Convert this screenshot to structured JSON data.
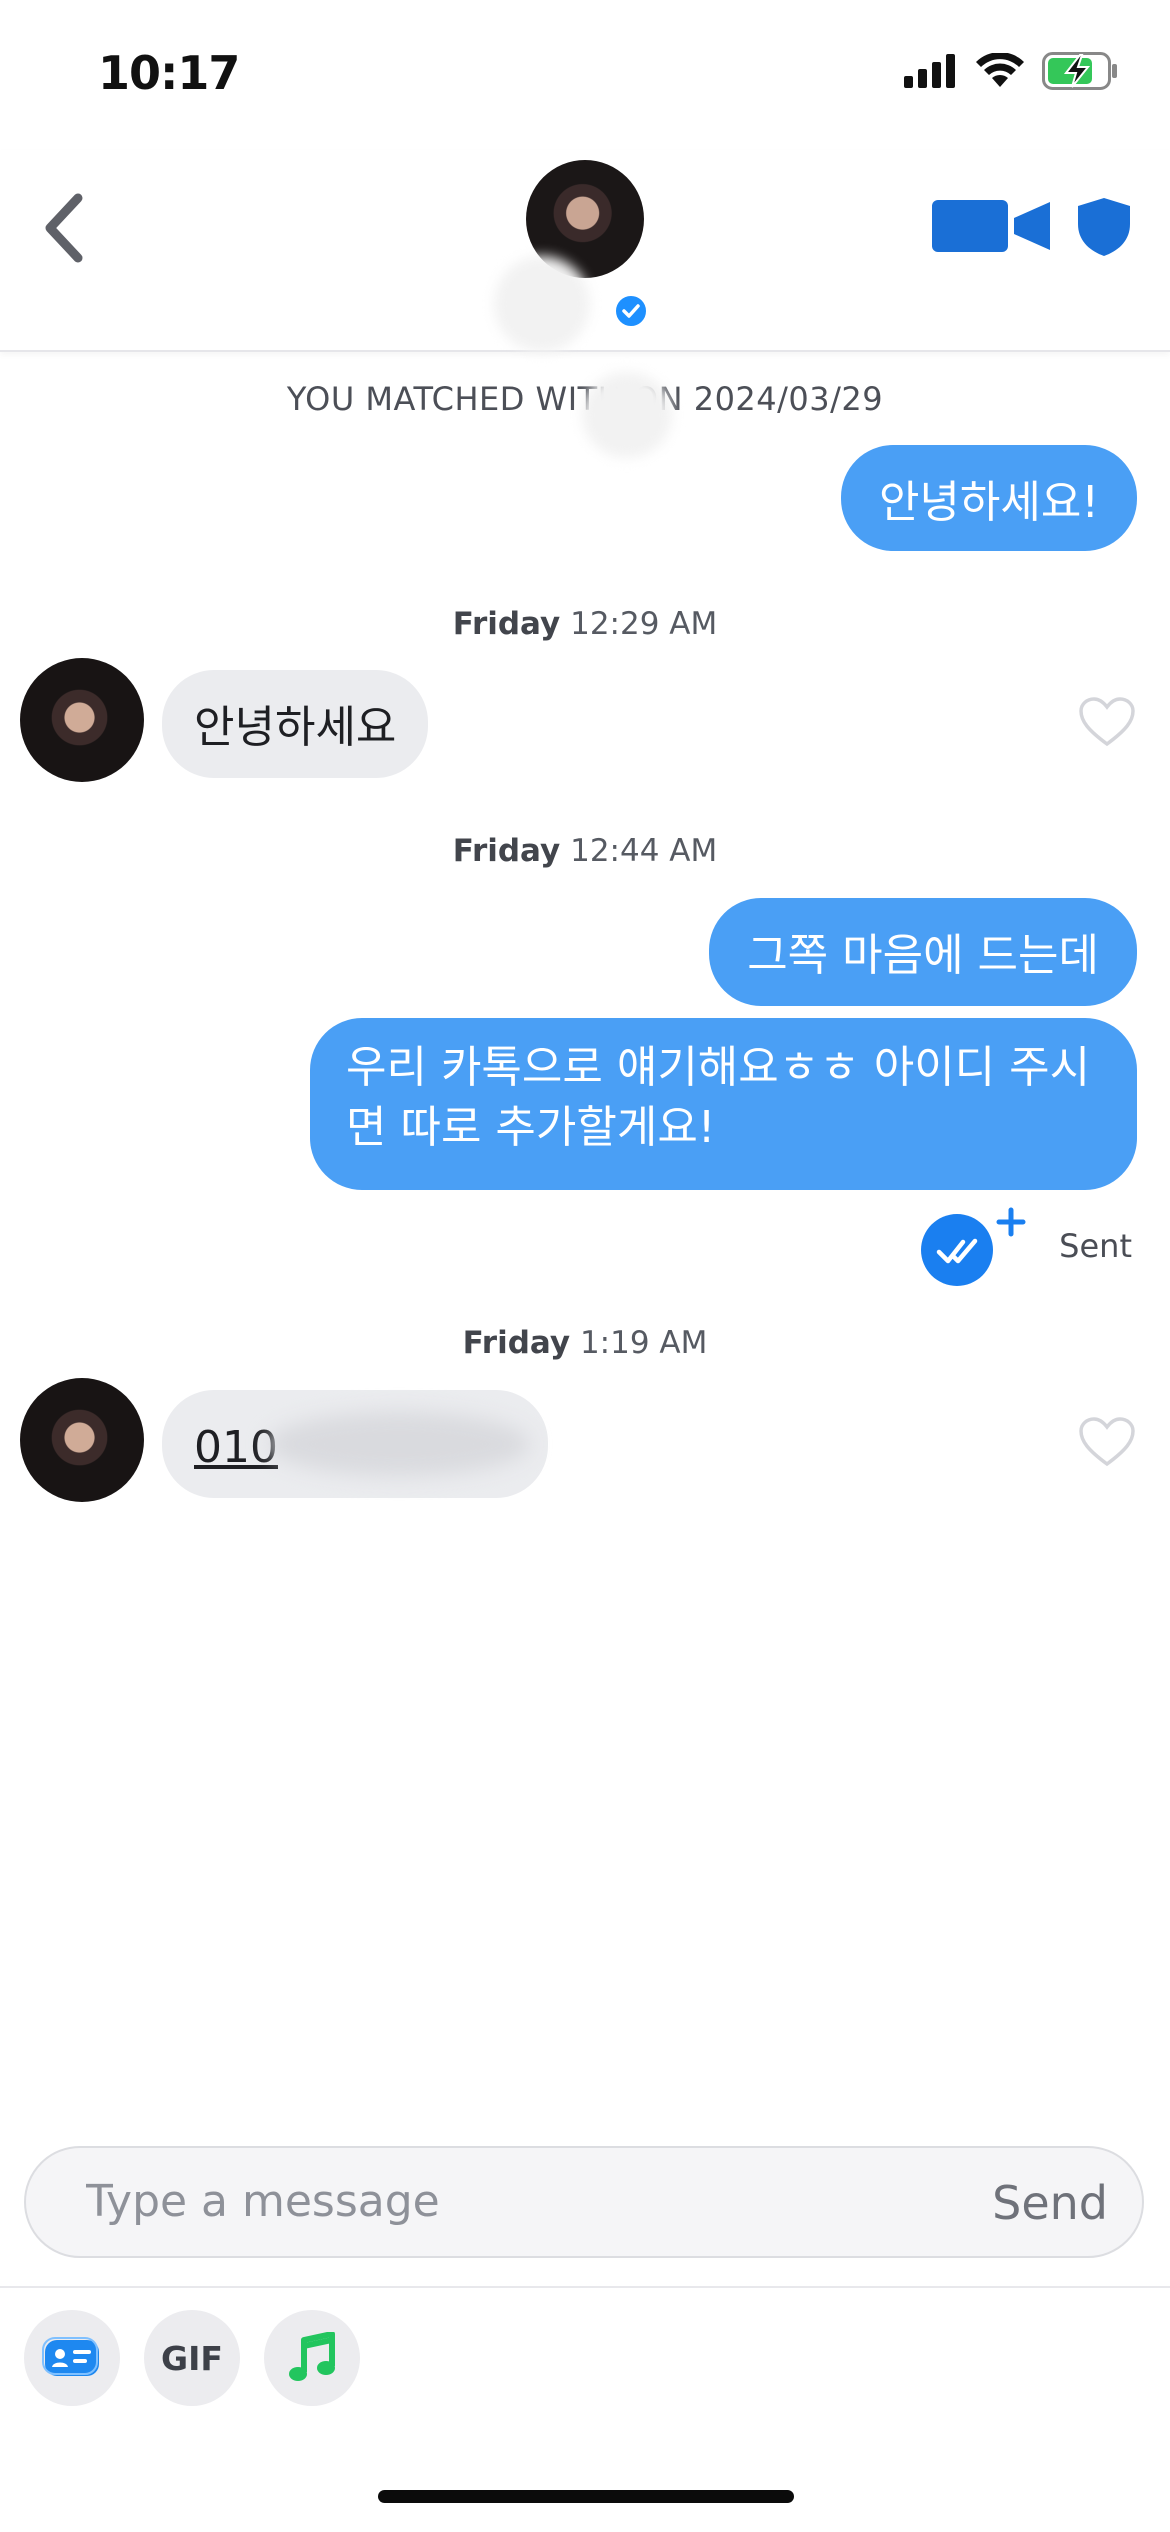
{
  "status_bar": {
    "time": "10:17"
  },
  "header": {
    "back_icon": "chevron-left-icon",
    "verified_icon": "verified-badge-icon",
    "video_icon": "video-camera-icon",
    "shield_icon": "shield-icon"
  },
  "chat": {
    "matched_banner": "YOU MATCHED WITH  ON 2024/03/29",
    "messages": [
      {
        "direction": "out",
        "text": "안녕하세요!"
      },
      {
        "day": "Friday",
        "time": "12:29 AM"
      },
      {
        "direction": "in",
        "text": "안녕하세요"
      },
      {
        "day": "Friday",
        "time": "12:44 AM"
      },
      {
        "direction": "out",
        "text": "그쪽 마음에 드는데"
      },
      {
        "direction": "out",
        "text": "우리 카톡으로 얘기해요ㅎㅎ 아이디 주시면 따로 추가할게요!"
      },
      {
        "status": "Sent"
      },
      {
        "day": "Friday",
        "time": "1:19 AM"
      },
      {
        "direction": "in",
        "text": "010"
      }
    ]
  },
  "composer": {
    "placeholder": "Type a message",
    "send_label": "Send"
  },
  "toolbar": {
    "card_icon": "profile-card-icon",
    "gif_label": "GIF",
    "music_icon": "music-note-icon"
  },
  "colors": {
    "outgoing_bubble": "#4a9ff5",
    "incoming_bubble": "#ebecef",
    "accent_blue": "#1a6fd6",
    "music_green": "#22c55e"
  }
}
